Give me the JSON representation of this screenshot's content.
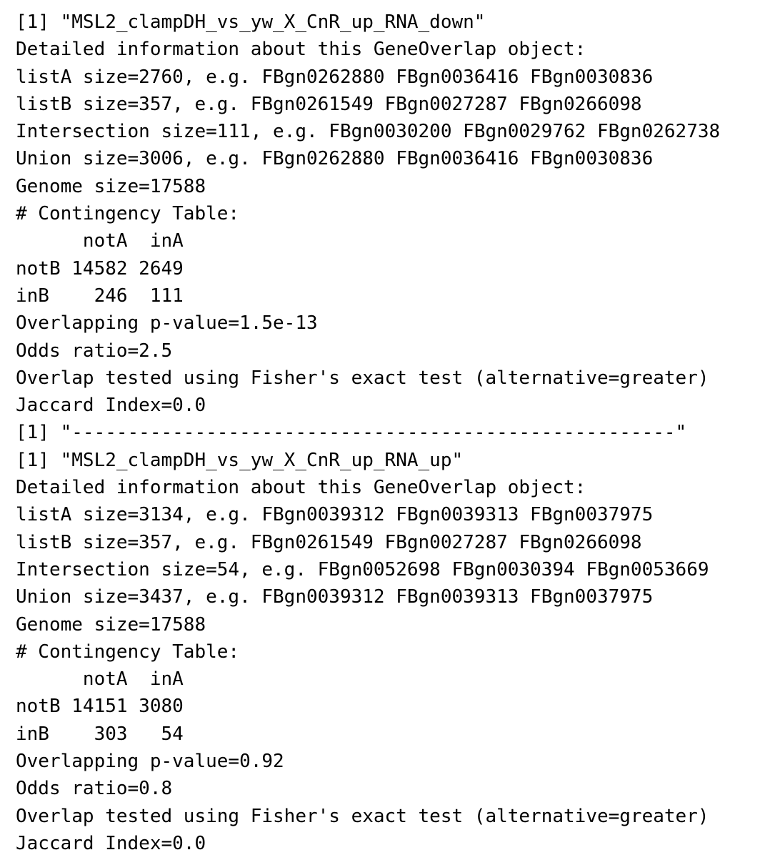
{
  "console": {
    "lines": [
      "[1] \"MSL2_clampDH_vs_yw_X_CnR_up_RNA_down\"",
      "Detailed information about this GeneOverlap object:",
      "listA size=2760, e.g. FBgn0262880 FBgn0036416 FBgn0030836",
      "listB size=357, e.g. FBgn0261549 FBgn0027287 FBgn0266098",
      "Intersection size=111, e.g. FBgn0030200 FBgn0029762 FBgn0262738",
      "Union size=3006, e.g. FBgn0262880 FBgn0036416 FBgn0030836",
      "Genome size=17588",
      "# Contingency Table:",
      "      notA  inA",
      "notB 14582 2649",
      "inB    246  111",
      "Overlapping p-value=1.5e-13",
      "Odds ratio=2.5",
      "Overlap tested using Fisher's exact test (alternative=greater)",
      "Jaccard Index=0.0",
      "[1] \"------------------------------------------------------\"",
      "[1] \"MSL2_clampDH_vs_yw_X_CnR_up_RNA_up\"",
      "Detailed information about this GeneOverlap object:",
      "listA size=3134, e.g. FBgn0039312 FBgn0039313 FBgn0037975",
      "listB size=357, e.g. FBgn0261549 FBgn0027287 FBgn0266098",
      "Intersection size=54, e.g. FBgn0052698 FBgn0030394 FBgn0053669",
      "Union size=3437, e.g. FBgn0039312 FBgn0039313 FBgn0037975",
      "Genome size=17588",
      "# Contingency Table:",
      "      notA  inA",
      "notB 14151 3080",
      "inB    303   54",
      "Overlapping p-value=0.92",
      "Odds ratio=0.8",
      "Overlap tested using Fisher's exact test (alternative=greater)",
      "Jaccard Index=0.0"
    ]
  }
}
